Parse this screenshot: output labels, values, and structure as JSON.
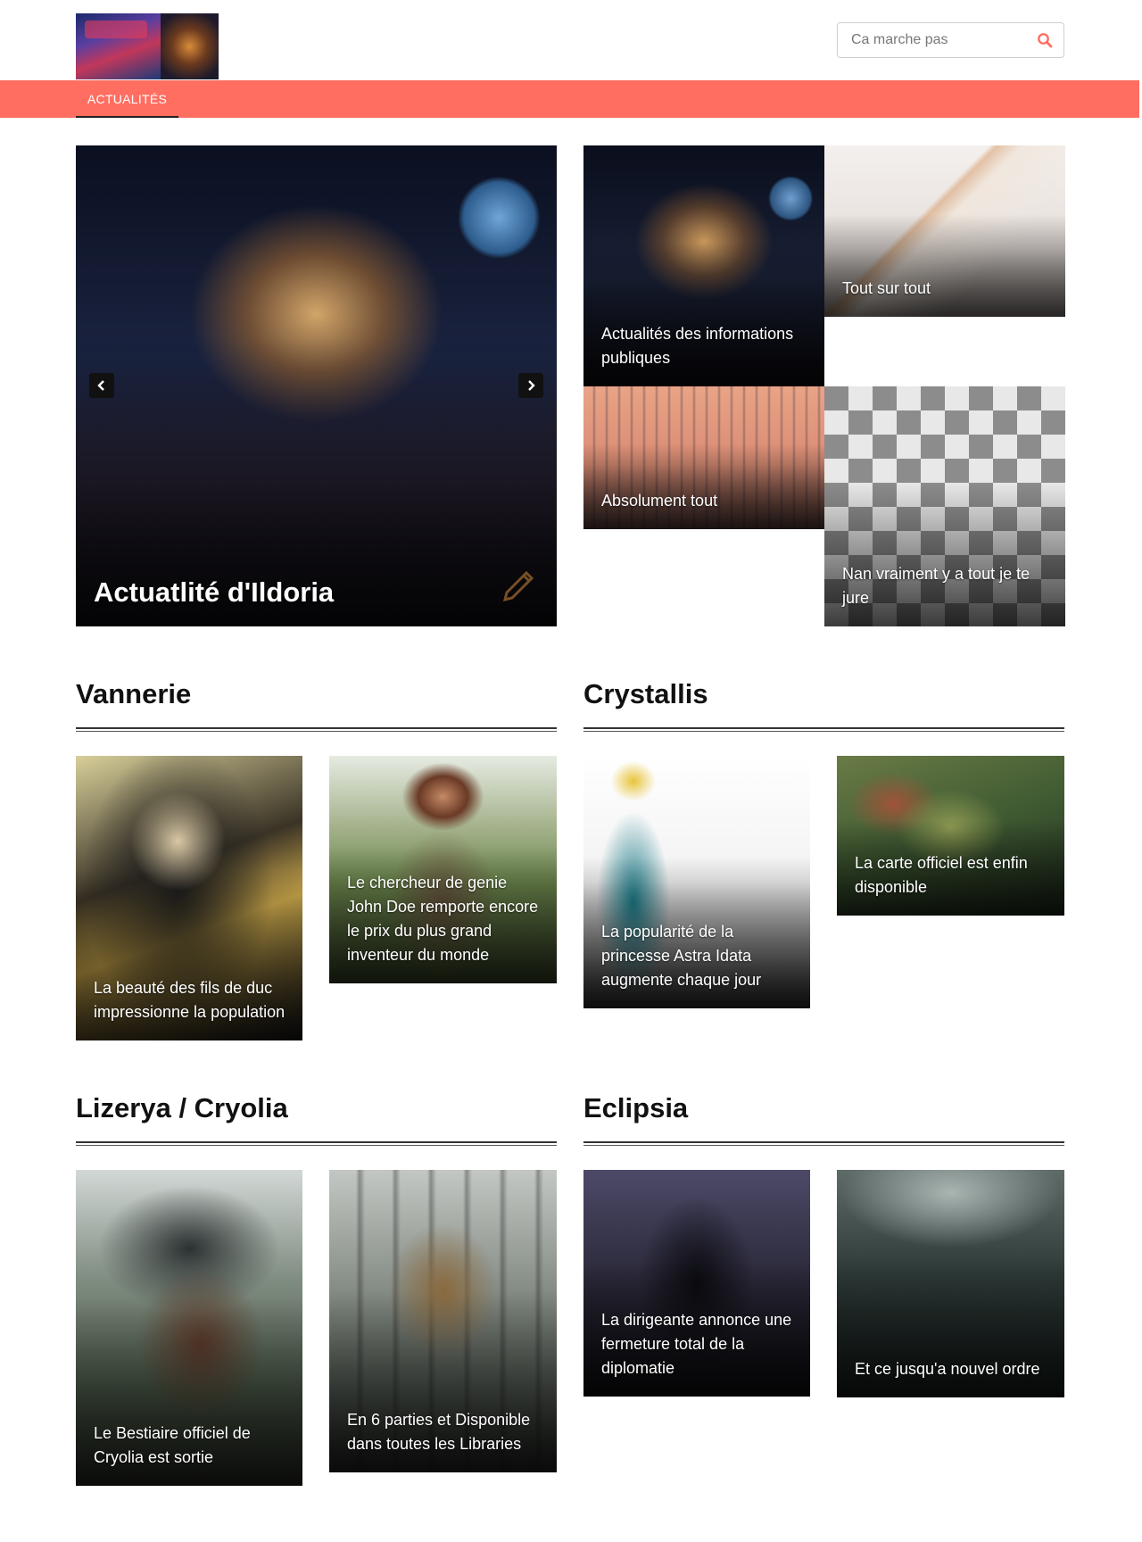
{
  "header": {
    "search": {
      "placeholder": "Ca marche pas"
    }
  },
  "nav": {
    "items": [
      {
        "label": "ACTUALITÉS"
      }
    ]
  },
  "featured": {
    "main": {
      "caption": "Actuatlité d'Ildoria"
    },
    "tiles": [
      {
        "caption": "Actualités des informations publiques"
      },
      {
        "caption": "Tout sur tout"
      },
      {
        "caption": "Absolument tout"
      },
      {
        "caption": "Nan vraiment y a tout je te jure"
      }
    ]
  },
  "sections": [
    {
      "title": "Vannerie",
      "articles": [
        {
          "caption": "La beauté des fils de duc impressionne la population"
        },
        {
          "caption": "Le chercheur de genie John Doe remporte encore le prix du plus grand inventeur du monde"
        }
      ]
    },
    {
      "title": "Crystallis",
      "articles": [
        {
          "caption": "La popularité de la princesse Astra Idata augmente chaque jour"
        },
        {
          "caption": "La carte officiel est enfin disponible"
        }
      ]
    },
    {
      "title": "Lizerya / Cryolia",
      "articles": [
        {
          "caption": "Le Bestiaire officiel de Cryolia est sortie"
        },
        {
          "caption": "En 6 parties et Disponible dans toutes les Libraries"
        }
      ]
    },
    {
      "title": "Eclipsia",
      "articles": [
        {
          "caption": "La dirigeante annonce une fermeture total de la diplomatie"
        },
        {
          "caption": "Et ce jusqu'a nouvel ordre"
        }
      ]
    }
  ],
  "colors": {
    "accent": "#ff6e61",
    "text": "#111111"
  },
  "icons": {
    "search": "search-icon",
    "prev": "chevron-left-icon",
    "next": "chevron-right-icon",
    "edit": "pencil-icon"
  }
}
